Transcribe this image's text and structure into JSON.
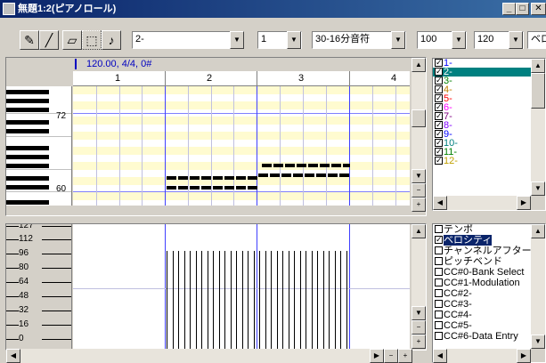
{
  "window": {
    "title": "無題1:2(ピアノロール)"
  },
  "toolbar": {
    "track_select": "2-",
    "channel_select": "1",
    "quantize_select": "30-16分音符",
    "velocity_select": "100",
    "length_select": "120",
    "extra_select": "ベロ"
  },
  "ruler": {
    "position_text": "120.00, 4/4, 0#",
    "measures": [
      "1",
      "2",
      "3",
      "4"
    ]
  },
  "keys": {
    "labels": [
      "72",
      "60"
    ]
  },
  "velocity_axis": {
    "labels": [
      "127",
      "112",
      "96",
      "80",
      "64",
      "48",
      "32",
      "16",
      "0"
    ]
  },
  "tracks": [
    {
      "label": "1-",
      "color": "#0000ff",
      "checked": true
    },
    {
      "label": "2-",
      "color": "#ffffff",
      "checked": true,
      "selected": true
    },
    {
      "label": "3-",
      "color": "#008000",
      "checked": true
    },
    {
      "label": "4-",
      "color": "#c08000",
      "checked": true
    },
    {
      "label": "5-",
      "color": "#ff0000",
      "checked": true
    },
    {
      "label": "6-",
      "color": "#ff00ff",
      "checked": true
    },
    {
      "label": "7-",
      "color": "#800080",
      "checked": true
    },
    {
      "label": "8-",
      "color": "#8000ff",
      "checked": true
    },
    {
      "label": "9-",
      "color": "#0000ff",
      "checked": true
    },
    {
      "label": "10-",
      "color": "#008080",
      "checked": true
    },
    {
      "label": "11-",
      "color": "#008000",
      "checked": true
    },
    {
      "label": "12-",
      "color": "#c0a000",
      "checked": true
    }
  ],
  "controllers": [
    {
      "label": "テンポ",
      "checked": false
    },
    {
      "label": "ベロシティ",
      "checked": true,
      "selected": true
    },
    {
      "label": "チャンネルアフタータッチ",
      "checked": false
    },
    {
      "label": "ピッチベンド",
      "checked": false
    },
    {
      "label": "CC#0-Bank Select",
      "checked": false
    },
    {
      "label": "CC#1-Modulation",
      "checked": false
    },
    {
      "label": "CC#2-",
      "checked": false
    },
    {
      "label": "CC#3-",
      "checked": false
    },
    {
      "label": "CC#4-",
      "checked": false
    },
    {
      "label": "CC#5-",
      "checked": false
    },
    {
      "label": "CC#6-Data Entry",
      "checked": false
    }
  ],
  "notes_count_hint": "two staircases of 8 notes"
}
